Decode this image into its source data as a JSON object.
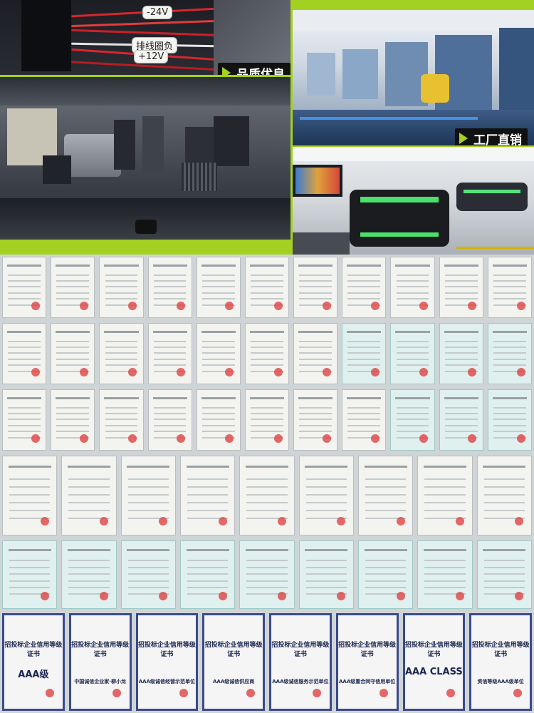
{
  "badges": {
    "quality": "品质优良",
    "factory": "工厂直销"
  },
  "labels": {
    "neg24": "-24V",
    "cable": "排线圈负",
    "pos12": "+12V"
  },
  "certs": {
    "aaa_title": "招投标企业信用等级证书",
    "aaa_items": [
      {
        "big": "AAA级",
        "sub": ""
      },
      {
        "big": "",
        "sub": "中国诚信企业家·柳小龙"
      },
      {
        "big": "",
        "sub": "AAA级诚信经营示范单位"
      },
      {
        "big": "",
        "sub": "AAA级诚信供应商"
      },
      {
        "big": "",
        "sub": "AAA级诚信服务示范单位"
      },
      {
        "big": "",
        "sub": "AAA级重合同守信用单位"
      },
      {
        "big": "AAA CLASS",
        "sub": ""
      },
      {
        "big": "",
        "sub": "资信等级AAA级单位"
      }
    ]
  },
  "colors": {
    "accent": "#a4d022",
    "badge_bg": "#111111"
  }
}
